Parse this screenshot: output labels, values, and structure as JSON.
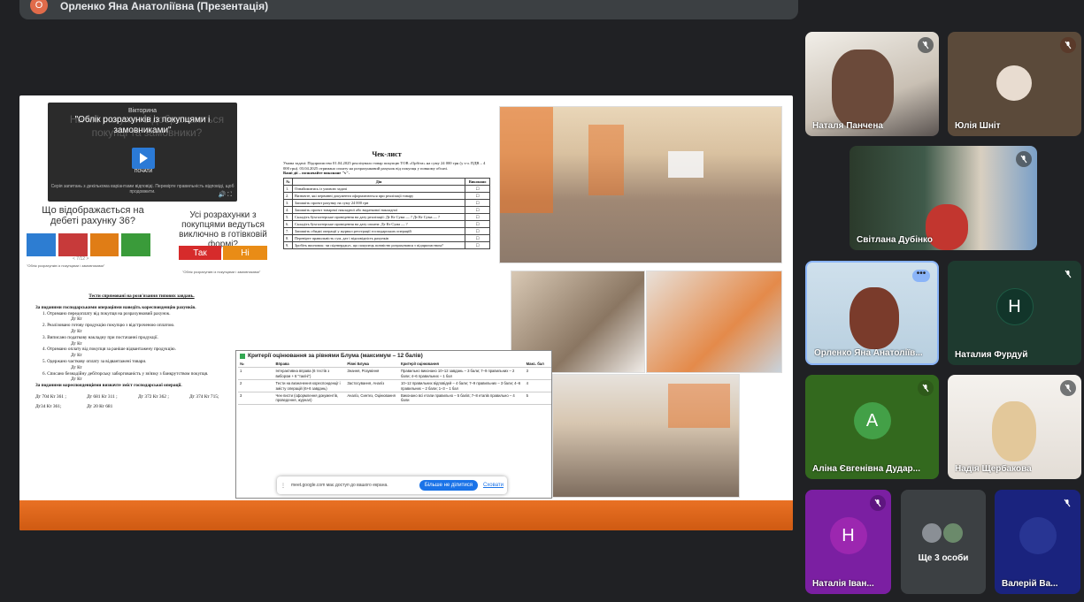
{
  "top": {
    "avatar_letter": "О",
    "title": "Орленко Яна Анатоліївна (Презентація)"
  },
  "slide": {
    "quiz": {
      "ghost": "На які рахунки відображаються покупці та замовники?",
      "label": "Вікторина",
      "title": "\"Облік розрахунків із покупцями і замовниками\"",
      "play_label": "ПОЧАТИ",
      "sub": "Серія запитань з декількома варіантами відповіді. Перевірте правильність відповіді, щоб продовжити."
    },
    "q1": "Що відображається на дебеті рахунку 36?",
    "q1_caption": "\"Облік розрахунків із покупцями і замовниками\"",
    "q1_nav": "< 7/12 >",
    "q2": "Усі розрахунки з покупцями ведуться виключно в готівковій формі?",
    "q2_yes": "Так",
    "q2_no": "Ні",
    "q2_caption": "\"Облік розрахунків із покупцями і замовниками\"",
    "doc1": {
      "title": "Тести спрямовані на розв'язання типових завдань.",
      "s1": "За поданими господарськими операціями наведіть кореспонденцію рахунків.",
      "items": [
        "1. Отримано передоплату від покупця на розрахунковий рахунок.",
        "Дт Кт",
        "2. Реалізовано готову продукцію покупцю з відстроченою оплатою.",
        "Дт Кт",
        "3. Виписано податкову накладну при постачанні продукції.",
        "Дт Кт",
        "4. Отримано оплату від покупця за раніше відвантажену продукцію.",
        "Дт Кт",
        "5. Одержано часткову оплату за відвантажені товари.",
        "Дт Кт",
        "6. Списано безнадійну дебіторську заборгованість у зв'язку з банкрутством покупця.",
        "Дт Кт"
      ],
      "s2": "За поданими кореспонденціями визначте зміст господарської операції.",
      "nums": [
        "Дт 704 Кт 361 ;",
        "Дт 681 Кт 311 ;",
        "Дт 372 Кт 362 ;",
        "Дт 374 Кт 715;",
        "Дт34 Кт 361;",
        "Дт 20 Кт 681"
      ]
    },
    "checklist": {
      "title": "Чек-лист",
      "condition": "Умова задачі: Підприємство 01.04.2025 реалізувало товар покупцю ТОВ «Орбіта» на суму 24 000 грн (у т.ч. ПДВ – 4 000 грн). 03.04.2025 отримано оплату на розрахунковий рахунок від покупця у повному обсязі.",
      "instr": "Ваші дії – позначайте виконане \"v\".",
      "headers": [
        "№",
        "Дія",
        "Виконано"
      ],
      "rows": [
        [
          "1.",
          "Ознайомитись із умовою задачі",
          "☐"
        ],
        [
          "2.",
          "Визначте, які первинні документи оформлюються при реалізації товару",
          "☐"
        ],
        [
          "3.",
          "Запишіть проект рахунку на суму 24 000 грн",
          "☐"
        ],
        [
          "4.",
          "Запишіть проект товарної накладної або видаткової накладної",
          "☐"
        ],
        [
          "5.",
          "Складіть бухгалтерське проведення на дату реалізації: Дт Кт Сума — ? Дт Кт Сума — ?",
          "☐"
        ],
        [
          "6.",
          "Складіть бухгалтерське проведення на дату оплати: Дт Кт Сума — ?",
          "☐"
        ],
        [
          "7.",
          "Запишіть обидві операції у журнал реєстрації господарських операцій",
          "☐"
        ],
        [
          "8.",
          "Перевірте правильність сум, дат і відповідність рахунків",
          "☐"
        ],
        [
          "9.",
          "Зробіть висновок: чи підтверджує, що покупець повністю розрахувався з підприємством?",
          "☐"
        ]
      ]
    },
    "bloom": {
      "title": "Критерії оцінювання за рівнями Блума (максимум – 12 балів)",
      "headers": [
        "№",
        "Вправа",
        "Рівні Блума",
        "Критерії оцінювання",
        "Макс. бал"
      ],
      "rows": [
        [
          "1",
          "Інтерактивна вправа (6 тестів з вибором + 6 \"так/ні\")",
          "Знання, Розуміння",
          "Правильно виконано 10–12 завдань – 3 бали; 7–9 правильних – 2 бали; 4–6 правильних – 1 бал",
          "3"
        ],
        [
          "2",
          "Тести на визначення кореспонденції і змісту операцій (6+6 завдань)",
          "Застосування, Аналіз",
          "10–12 правильних відповідей – 4 бали; 7–9 правильних – 3 бали; 4–6 правильних – 2 бали; 1–3 – 1 бал",
          "4"
        ],
        [
          "3",
          "Чек-листи (оформлення документів, проведення, журнал)",
          "Аналіз, Синтез, Оцінювання",
          "Виконано всі етапи правильно – 5 балів; 7–8 етапів правильно – 4 бали",
          "5"
        ]
      ],
      "share_msg": "meet.google.com має доступ до вашого екрана.",
      "share_stop": "Більше не ділитися",
      "share_hide": "Сховати"
    }
  },
  "participants": [
    {
      "name": "Наталя Панчена",
      "muted": true
    },
    {
      "name": "Юлія Шніт",
      "muted": true
    },
    {
      "name": "Світлана Дубінко",
      "muted": true
    },
    {
      "name": "Орленко Яна Анатоліїв...",
      "muted": false
    },
    {
      "name": "Наталия Фурдуй",
      "letter": "Н",
      "muted": true
    },
    {
      "name": "Аліна Євгенівна Дудар...",
      "letter": "А",
      "muted": true
    },
    {
      "name": "Надія Щербакова",
      "muted": true
    },
    {
      "name": "Наталія Іван...",
      "letter": "Н",
      "muted": true
    },
    {
      "name": "Ще 3 особи"
    },
    {
      "name": "Валерій Ва...",
      "muted": true
    }
  ],
  "colors": {
    "bg": "#202124",
    "tile": "#3c4043",
    "accent": "#1a73e8",
    "slide_footer": "#e97124"
  }
}
